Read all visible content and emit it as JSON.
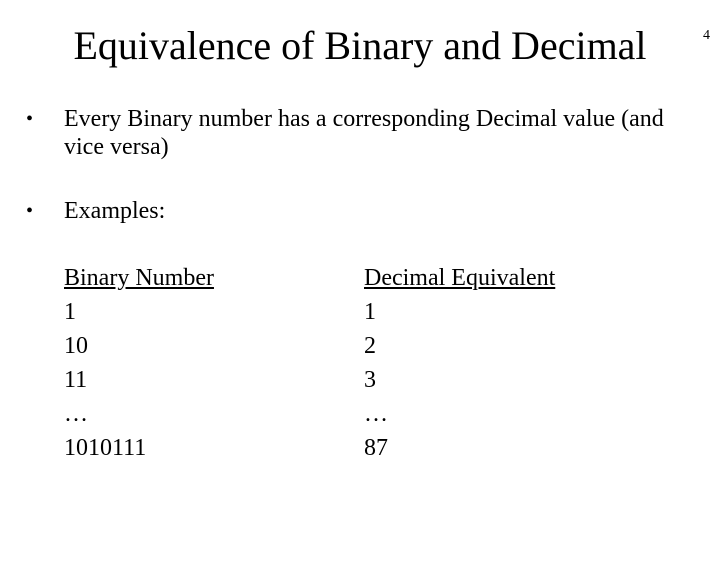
{
  "page_number": "4",
  "title": "Equivalence of Binary and Decimal",
  "bullets": {
    "b1": "Every Binary number has a corresponding Decimal value (and vice versa)",
    "b2": "Examples:"
  },
  "table": {
    "headers": {
      "binary": "Binary Number",
      "decimal": "Decimal Equivalent"
    },
    "rows": [
      {
        "binary": "1",
        "decimal": "1"
      },
      {
        "binary": "10",
        "decimal": "2"
      },
      {
        "binary": "11",
        "decimal": "3"
      },
      {
        "binary": "…",
        "decimal": "…"
      },
      {
        "binary": "1010111",
        "decimal": "87"
      }
    ]
  }
}
